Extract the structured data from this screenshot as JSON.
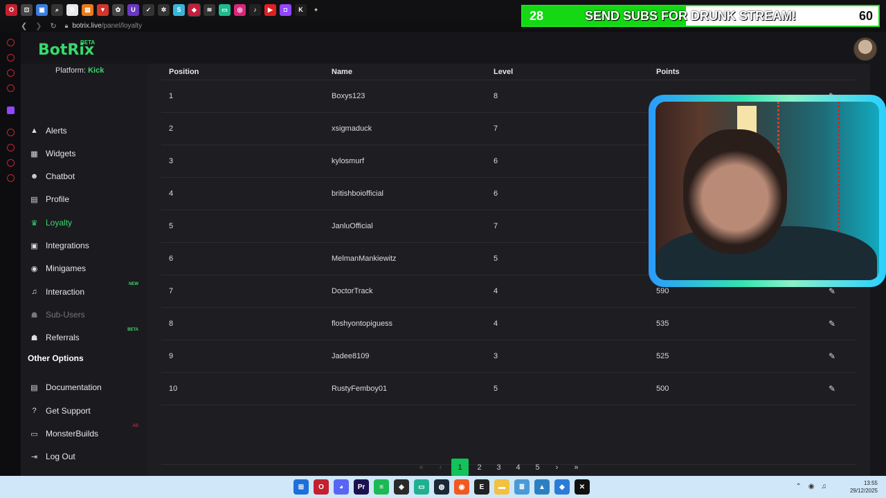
{
  "browser": {
    "tabs": [
      {
        "icon": "opera-icon",
        "color": "#c4202f",
        "glyph": "O"
      },
      {
        "icon": "game-controller-icon",
        "color": "#444",
        "glyph": "⊡"
      },
      {
        "icon": "image-icon",
        "color": "#3b7ddd",
        "glyph": "▣"
      },
      {
        "icon": "search-icon",
        "color": "#333",
        "glyph": "⌕"
      },
      {
        "icon": "app-b-icon",
        "color": "#e9e9e9",
        "glyph": "B"
      },
      {
        "icon": "orange-app-icon",
        "color": "#e87b1a",
        "glyph": "▤"
      },
      {
        "icon": "red-app-icon",
        "color": "#d3342b",
        "glyph": "▼"
      },
      {
        "icon": "chatgpt-icon",
        "color": "#444",
        "glyph": "✿"
      },
      {
        "icon": "u-app-icon",
        "color": "#6a38c0",
        "glyph": "U"
      },
      {
        "icon": "check-app-icon",
        "color": "#333",
        "glyph": "✓"
      },
      {
        "icon": "gear-app-icon",
        "color": "#333",
        "glyph": "✲"
      },
      {
        "icon": "s-app-icon",
        "color": "#3ab4d6",
        "glyph": "S"
      },
      {
        "icon": "botrix-tab-icon",
        "color": "#c41e3a",
        "glyph": "◆"
      },
      {
        "icon": "stack-icon",
        "color": "#333",
        "glyph": "≋"
      },
      {
        "icon": "chat-app-icon",
        "color": "#1dbb8e",
        "glyph": "▭"
      },
      {
        "icon": "instagram-icon",
        "color": "#d6287b",
        "glyph": "◎"
      },
      {
        "icon": "tiktok-icon",
        "color": "#222",
        "glyph": "♪"
      },
      {
        "icon": "youtube-icon",
        "color": "#e02020",
        "glyph": "▶"
      },
      {
        "icon": "twitch-icon",
        "color": "#9146ff",
        "glyph": "◘"
      },
      {
        "icon": "kick-icon",
        "color": "#1e1e1e",
        "glyph": "K"
      },
      {
        "icon": "new-tab-icon",
        "color": "#111",
        "glyph": "+"
      }
    ],
    "url_host": "botrix.live",
    "url_path": "/panel/loyalty"
  },
  "overlay": {
    "sub_count": "28",
    "message": "SEND SUBS FOR DRUNK STREAM!",
    "goal": "60",
    "progress": 0.46
  },
  "app": {
    "logo": "BotRix",
    "logo_badge": "BETA",
    "platform_label": "Platform:",
    "platform_value": "Kick"
  },
  "sidebar": {
    "items": [
      {
        "label": "Alerts",
        "icon": "warning-icon",
        "glyph": "▲",
        "name": "sidebar-item-alerts",
        "state": "normal",
        "badge": ""
      },
      {
        "label": "Widgets",
        "icon": "grid-icon",
        "glyph": "▦",
        "name": "sidebar-item-widgets",
        "state": "normal",
        "badge": ""
      },
      {
        "label": "Chatbot",
        "icon": "robot-icon",
        "glyph": "☻",
        "name": "sidebar-item-chatbot",
        "state": "normal",
        "badge": ""
      },
      {
        "label": "Profile",
        "icon": "id-card-icon",
        "glyph": "▤",
        "name": "sidebar-item-profile",
        "state": "normal",
        "badge": ""
      },
      {
        "label": "Loyalty",
        "icon": "trophy-icon",
        "glyph": "♛",
        "name": "sidebar-item-loyalty",
        "state": "active",
        "badge": ""
      },
      {
        "label": "Integrations",
        "icon": "plug-icon",
        "glyph": "▣",
        "name": "sidebar-item-integrations",
        "state": "normal",
        "badge": ""
      },
      {
        "label": "Minigames",
        "icon": "gamepad-icon",
        "glyph": "◉",
        "name": "sidebar-item-minigames",
        "state": "normal",
        "badge": ""
      },
      {
        "label": "Interaction",
        "icon": "music-icon",
        "glyph": "♫",
        "name": "sidebar-item-interaction",
        "state": "normal",
        "badge": "NEW",
        "badge_color": "#38d96b"
      },
      {
        "label": "Sub-Users",
        "icon": "users-icon",
        "glyph": "☗",
        "name": "sidebar-item-sub-users",
        "state": "disabled",
        "badge": ""
      },
      {
        "label": "Referrals",
        "icon": "group-icon",
        "glyph": "☗",
        "name": "sidebar-item-referrals",
        "state": "normal",
        "badge": "BETA",
        "badge_color": "#38d96b"
      }
    ],
    "other_title": "Other Options",
    "other_items": [
      {
        "label": "Documentation",
        "icon": "book-icon",
        "glyph": "▤",
        "name": "sidebar-item-documentation",
        "badge": ""
      },
      {
        "label": "Get Support",
        "icon": "question-icon",
        "glyph": "?",
        "name": "sidebar-item-get-support",
        "badge": ""
      },
      {
        "label": "MonsterBuilds",
        "icon": "laptop-icon",
        "glyph": "▭",
        "name": "sidebar-item-monsterbuilds",
        "badge": "AD",
        "badge_color": "#c0253b"
      },
      {
        "label": "Log Out",
        "icon": "logout-icon",
        "glyph": "⇥",
        "name": "sidebar-item-log-out",
        "badge": ""
      }
    ]
  },
  "table": {
    "headers": [
      "Position",
      "Name",
      "Level",
      "Points"
    ],
    "rows": [
      {
        "position": "1",
        "name": "Boxys123",
        "level": "8",
        "points": ""
      },
      {
        "position": "2",
        "name": "xsigmaduck",
        "level": "7",
        "points": ""
      },
      {
        "position": "3",
        "name": "kylosmurf",
        "level": "6",
        "points": ""
      },
      {
        "position": "4",
        "name": "britishboiofficial",
        "level": "6",
        "points": ""
      },
      {
        "position": "5",
        "name": "JanluOfficial",
        "level": "7",
        "points": ""
      },
      {
        "position": "6",
        "name": "MelmanMankiewitz",
        "level": "5",
        "points": ""
      },
      {
        "position": "7",
        "name": "DoctorTrack",
        "level": "4",
        "points": "590"
      },
      {
        "position": "8",
        "name": "floshyontopiguess",
        "level": "4",
        "points": "535"
      },
      {
        "position": "9",
        "name": "Jadee8109",
        "level": "3",
        "points": "525"
      },
      {
        "position": "10",
        "name": "RustyFemboy01",
        "level": "5",
        "points": "500"
      }
    ]
  },
  "pagination": {
    "first": "«",
    "prev": "‹",
    "pages": [
      "1",
      "2",
      "3",
      "4",
      "5"
    ],
    "current": "1",
    "next": "›",
    "last": "»"
  },
  "taskbar": {
    "icons": [
      {
        "icon": "windows-start-icon",
        "color": "#1e6fd9",
        "glyph": "⊞"
      },
      {
        "icon": "opera-taskbar-icon",
        "color": "#c4202f",
        "glyph": "O"
      },
      {
        "icon": "discord-icon",
        "color": "#5865f2",
        "glyph": "◕"
      },
      {
        "icon": "premiere-icon",
        "color": "#1b1150",
        "glyph": "Pr"
      },
      {
        "icon": "spotify-icon",
        "color": "#1db954",
        "glyph": "≡"
      },
      {
        "icon": "nvidia-icon",
        "color": "#2a2a2a",
        "glyph": "◈"
      },
      {
        "icon": "chat-taskbar-icon",
        "color": "#20b090",
        "glyph": "▭"
      },
      {
        "icon": "steam-icon",
        "color": "#1b2838",
        "glyph": "◍"
      },
      {
        "icon": "origin-icon",
        "color": "#f05a22",
        "glyph": "◉"
      },
      {
        "icon": "epic-icon",
        "color": "#222",
        "glyph": "E"
      },
      {
        "icon": "folder-icon",
        "color": "#f3c040",
        "glyph": "▬"
      },
      {
        "icon": "notepad-icon",
        "color": "#4a9ad8",
        "glyph": "≣"
      },
      {
        "icon": "photos-icon",
        "color": "#2d80c0",
        "glyph": "▲"
      },
      {
        "icon": "vscode-icon",
        "color": "#2b7bd8",
        "glyph": "◆"
      },
      {
        "icon": "capcut-icon",
        "color": "#111",
        "glyph": "✕"
      }
    ],
    "time": "13:55",
    "date": "29/12/2025"
  }
}
